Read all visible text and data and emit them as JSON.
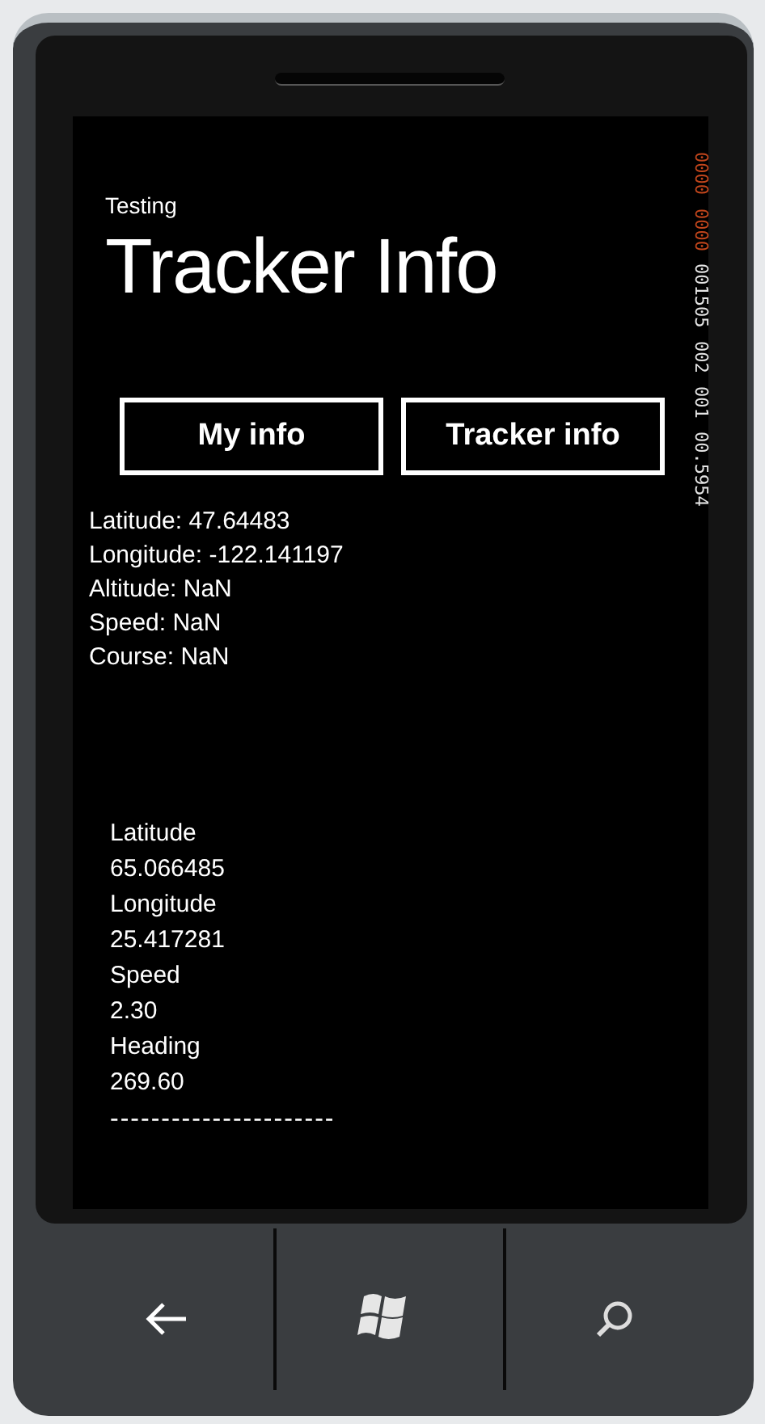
{
  "app": {
    "subtitle": "Testing",
    "title": "Tracker Info"
  },
  "buttons": [
    {
      "label": "My info"
    },
    {
      "label": "Tracker info"
    }
  ],
  "my_info": [
    "Latitude: 47.64483",
    "Longitude: -122.141197",
    "Altitude: NaN",
    "Speed: NaN",
    "Course: NaN"
  ],
  "tracker_info": [
    "Latitude",
    "65.066485",
    "Longitude",
    "25.417281",
    "Speed",
    "2.30",
    "Heading",
    "269.60"
  ],
  "separator": "----------------------",
  "frame_counters": [
    {
      "value": "0000",
      "color": "#c2461c"
    },
    {
      "value": "0000",
      "color": "#c2461c"
    },
    {
      "value": "001505",
      "color": "#e5e5e5"
    },
    {
      "value": "002",
      "color": "#e5e5e5"
    },
    {
      "value": "001",
      "color": "#e5e5e5"
    },
    {
      "value": "00.5954",
      "color": "#e5e5e5"
    }
  ]
}
